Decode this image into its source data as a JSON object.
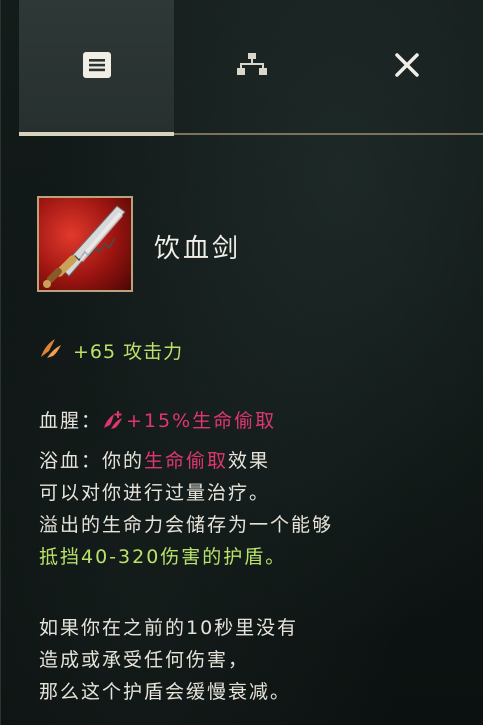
{
  "tabs": [
    {
      "name": "item-details",
      "icon": "list-icon",
      "active": true
    },
    {
      "name": "build-tree",
      "icon": "tree-icon",
      "active": false
    },
    {
      "name": "close",
      "icon": "close-icon",
      "active": false
    }
  ],
  "item": {
    "name": "饮血剑",
    "icon": "bloodthirster-sword-icon"
  },
  "stat": {
    "icon": "attack-damage-icon",
    "text": "+65 攻击力"
  },
  "passive1": {
    "label": "血腥：",
    "icon": "lifesteal-icon",
    "value": "+15%生命偷取"
  },
  "passive2": {
    "label": "浴血：",
    "text_a": "你的",
    "highlight": "生命偷取",
    "text_b": "效果",
    "line2": "可以对你进行过量治疗。",
    "line3": "溢出的生命力会储存为一个能够",
    "line4": "抵挡40-320伤害的护盾。"
  },
  "note": {
    "line1": "如果你在之前的10秒里没有",
    "line2": "造成或承受任何伤害，",
    "line3": "那么这个护盾会缓慢衰减。"
  },
  "colors": {
    "highlight_pink": "#e0366f",
    "highlight_green": "#b9e26a",
    "tab_underline": "#d9d2bd"
  }
}
